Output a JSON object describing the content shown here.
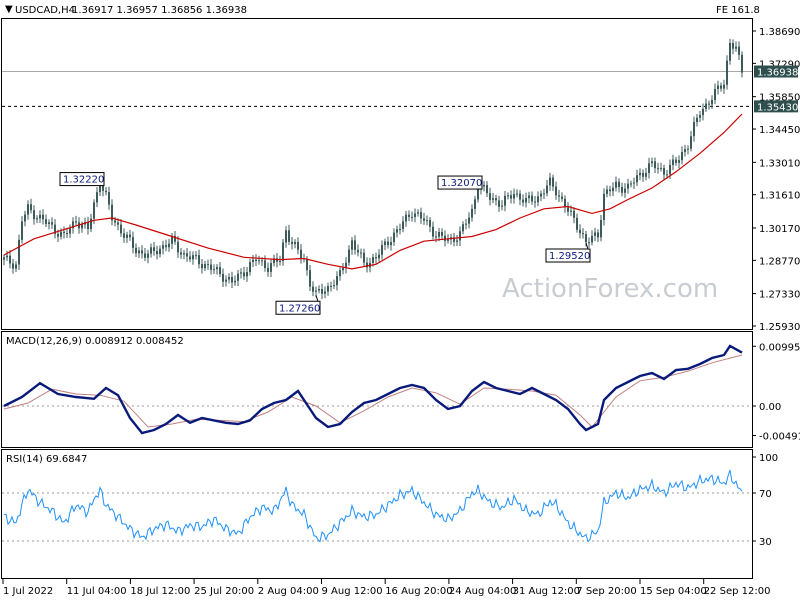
{
  "header": {
    "symbol": "USDCAD,H4",
    "ohlc": "1.36917 1.36957 1.36856 1.36938",
    "fe_label": "FE 161.8"
  },
  "watermark": "ActionForex.com",
  "colors": {
    "candles": "#3c5a5a",
    "ma": "#cc0000",
    "macd": "#0a1a7a",
    "signal": "#c08080",
    "rsi": "#1e90ff",
    "price_tag_bg": "#2f4f4f"
  },
  "chart_data": [
    {
      "type": "candlestick",
      "panel": "price",
      "ylim": [
        1.2593,
        1.3869
      ],
      "yticks": [
        "1.38690",
        "1.37290",
        "1.35850",
        "1.34450",
        "1.33010",
        "1.31610",
        "1.30170",
        "1.28770",
        "1.27330",
        "1.25930"
      ],
      "current_price": "1.36938",
      "level_line": "1.35430",
      "annotations": [
        {
          "label": "1.32220",
          "x": 16,
          "y": 1.3222
        },
        {
          "label": "1.27260",
          "x": 52,
          "y": 1.2726
        },
        {
          "label": "1.32070",
          "x": 79,
          "y": 1.3207
        },
        {
          "label": "1.29520",
          "x": 97,
          "y": 1.2952
        }
      ],
      "close_path": [
        [
          0,
          1.288
        ],
        [
          2,
          1.286
        ],
        [
          3,
          1.305
        ],
        [
          4,
          1.31
        ],
        [
          6,
          1.306
        ],
        [
          8,
          1.302
        ],
        [
          10,
          1.298
        ],
        [
          12,
          1.305
        ],
        [
          14,
          1.301
        ],
        [
          15,
          1.312
        ],
        [
          16,
          1.3222
        ],
        [
          17,
          1.315
        ],
        [
          18,
          1.306
        ],
        [
          20,
          1.299
        ],
        [
          22,
          1.292
        ],
        [
          24,
          1.29
        ],
        [
          26,
          1.293
        ],
        [
          28,
          1.296
        ],
        [
          30,
          1.29
        ],
        [
          32,
          1.288
        ],
        [
          34,
          1.285
        ],
        [
          36,
          1.282
        ],
        [
          38,
          1.278
        ],
        [
          40,
          1.283
        ],
        [
          42,
          1.288
        ],
        [
          44,
          1.285
        ],
        [
          46,
          1.288
        ],
        [
          47,
          1.301
        ],
        [
          48,
          1.295
        ],
        [
          50,
          1.288
        ],
        [
          51,
          1.278
        ],
        [
          52,
          1.2726
        ],
        [
          54,
          1.276
        ],
        [
          56,
          1.281
        ],
        [
          58,
          1.296
        ],
        [
          60,
          1.286
        ],
        [
          62,
          1.289
        ],
        [
          64,
          1.296
        ],
        [
          66,
          1.302
        ],
        [
          68,
          1.309
        ],
        [
          70,
          1.305
        ],
        [
          72,
          1.299
        ],
        [
          74,
          1.296
        ],
        [
          76,
          1.299
        ],
        [
          78,
          1.309
        ],
        [
          79,
          1.3207
        ],
        [
          81,
          1.315
        ],
        [
          83,
          1.312
        ],
        [
          85,
          1.317
        ],
        [
          87,
          1.313
        ],
        [
          89,
          1.315
        ],
        [
          91,
          1.321
        ],
        [
          92,
          1.318
        ],
        [
          94,
          1.309
        ],
        [
          96,
          1.301
        ],
        [
          97,
          1.2952
        ],
        [
          99,
          1.299
        ],
        [
          100,
          1.316
        ],
        [
          102,
          1.32
        ],
        [
          104,
          1.319
        ],
        [
          106,
          1.325
        ],
        [
          108,
          1.329
        ],
        [
          110,
          1.326
        ],
        [
          112,
          1.33
        ],
        [
          114,
          1.338
        ],
        [
          116,
          1.352
        ],
        [
          118,
          1.358
        ],
        [
          120,
          1.365
        ],
        [
          121,
          1.382
        ],
        [
          122,
          1.379
        ],
        [
          123,
          1.3694
        ]
      ],
      "ma_path": [
        [
          0,
          1.29
        ],
        [
          5,
          1.297
        ],
        [
          10,
          1.301
        ],
        [
          15,
          1.305
        ],
        [
          18,
          1.306
        ],
        [
          22,
          1.303
        ],
        [
          28,
          1.298
        ],
        [
          34,
          1.293
        ],
        [
          40,
          1.289
        ],
        [
          46,
          1.288
        ],
        [
          50,
          1.2885
        ],
        [
          54,
          1.286
        ],
        [
          58,
          1.284
        ],
        [
          62,
          1.286
        ],
        [
          66,
          1.292
        ],
        [
          70,
          1.296
        ],
        [
          74,
          1.297
        ],
        [
          78,
          1.298
        ],
        [
          82,
          1.301
        ],
        [
          86,
          1.306
        ],
        [
          90,
          1.31
        ],
        [
          94,
          1.311
        ],
        [
          98,
          1.308
        ],
        [
          101,
          1.31
        ],
        [
          104,
          1.314
        ],
        [
          108,
          1.319
        ],
        [
          112,
          1.326
        ],
        [
          116,
          1.334
        ],
        [
          120,
          1.343
        ],
        [
          123,
          1.351
        ]
      ]
    },
    {
      "type": "line",
      "panel": "macd",
      "title": "MACD(12,26,9) 0.008912 0.008452",
      "ylim": [
        -0.006,
        0.011
      ],
      "yticks": [
        "0.009956",
        "0.00",
        "-0.004912"
      ],
      "series": [
        {
          "values": [
            [
              0,
              0.0
            ],
            [
              3,
              0.0015
            ],
            [
              6,
              0.0038
            ],
            [
              9,
              0.002
            ],
            [
              12,
              0.0015
            ],
            [
              15,
              0.0012
            ],
            [
              17,
              0.003
            ],
            [
              19,
              0.0018
            ],
            [
              21,
              -0.002
            ],
            [
              23,
              -0.0045
            ],
            [
              25,
              -0.004
            ],
            [
              27,
              -0.003
            ],
            [
              29,
              -0.0015
            ],
            [
              31,
              -0.0028
            ],
            [
              33,
              -0.002
            ],
            [
              35,
              -0.0024
            ],
            [
              37,
              -0.0028
            ],
            [
              39,
              -0.003
            ],
            [
              41,
              -0.0024
            ],
            [
              43,
              -0.0005
            ],
            [
              45,
              0.0005
            ],
            [
              47,
              0.001
            ],
            [
              49,
              0.0025
            ],
            [
              51,
              -0.0005
            ],
            [
              52,
              -0.002
            ],
            [
              54,
              -0.0035
            ],
            [
              56,
              -0.003
            ],
            [
              58,
              -0.001
            ],
            [
              60,
              0.0005
            ],
            [
              62,
              0.001
            ],
            [
              64,
              0.002
            ],
            [
              66,
              0.003
            ],
            [
              68,
              0.0035
            ],
            [
              70,
              0.003
            ],
            [
              72,
              0.001
            ],
            [
              74,
              -0.0005
            ],
            [
              76,
              0.0
            ],
            [
              78,
              0.0025
            ],
            [
              80,
              0.004
            ],
            [
              82,
              0.003
            ],
            [
              84,
              0.0025
            ],
            [
              86,
              0.002
            ],
            [
              88,
              0.003
            ],
            [
              90,
              0.002
            ],
            [
              92,
              0.001
            ],
            [
              94,
              -0.0005
            ],
            [
              96,
              -0.003
            ],
            [
              97,
              -0.004
            ],
            [
              99,
              -0.003
            ],
            [
              100,
              0.001
            ],
            [
              102,
              0.003
            ],
            [
              104,
              0.004
            ],
            [
              106,
              0.005
            ],
            [
              108,
              0.0055
            ],
            [
              110,
              0.0045
            ],
            [
              112,
              0.006
            ],
            [
              114,
              0.0062
            ],
            [
              116,
              0.007
            ],
            [
              118,
              0.008
            ],
            [
              120,
              0.0085
            ],
            [
              121,
              0.01
            ],
            [
              123,
              0.0089
            ]
          ]
        },
        {
          "values": [
            [
              0,
              -0.0005
            ],
            [
              4,
              0.0005
            ],
            [
              8,
              0.0028
            ],
            [
              12,
              0.002
            ],
            [
              16,
              0.0018
            ],
            [
              20,
              0.0008
            ],
            [
              24,
              -0.0035
            ],
            [
              28,
              -0.003
            ],
            [
              32,
              -0.0022
            ],
            [
              36,
              -0.0024
            ],
            [
              40,
              -0.0026
            ],
            [
              44,
              -0.001
            ],
            [
              48,
              0.0015
            ],
            [
              52,
              0.0
            ],
            [
              56,
              -0.0028
            ],
            [
              60,
              -0.0008
            ],
            [
              64,
              0.0015
            ],
            [
              68,
              0.003
            ],
            [
              72,
              0.0022
            ],
            [
              76,
              0.0003
            ],
            [
              80,
              0.003
            ],
            [
              84,
              0.0028
            ],
            [
              88,
              0.0025
            ],
            [
              92,
              0.0018
            ],
            [
              96,
              -0.0015
            ],
            [
              98,
              -0.0035
            ],
            [
              102,
              0.0015
            ],
            [
              106,
              0.0042
            ],
            [
              110,
              0.0048
            ],
            [
              114,
              0.0058
            ],
            [
              118,
              0.0072
            ],
            [
              123,
              0.0085
            ]
          ]
        }
      ]
    },
    {
      "type": "line",
      "panel": "rsi",
      "title": "RSI(14) 69.6847",
      "ylim": [
        0,
        100
      ],
      "yticks": [
        "100",
        "70",
        "30"
      ],
      "series": [
        {
          "values": [
            [
              0,
              50
            ],
            [
              2,
              45
            ],
            [
              3,
              60
            ],
            [
              4,
              73
            ],
            [
              6,
              62
            ],
            [
              8,
              55
            ],
            [
              10,
              45
            ],
            [
              12,
              60
            ],
            [
              14,
              54
            ],
            [
              15,
              65
            ],
            [
              16,
              72
            ],
            [
              17,
              60
            ],
            [
              19,
              50
            ],
            [
              21,
              40
            ],
            [
              23,
              33
            ],
            [
              25,
              40
            ],
            [
              27,
              44
            ],
            [
              29,
              38
            ],
            [
              31,
              43
            ],
            [
              33,
              42
            ],
            [
              35,
              48
            ],
            [
              37,
              40
            ],
            [
              39,
              36
            ],
            [
              41,
              50
            ],
            [
              43,
              58
            ],
            [
              45,
              55
            ],
            [
              47,
              72
            ],
            [
              48,
              60
            ],
            [
              50,
              52
            ],
            [
              52,
              32
            ],
            [
              54,
              35
            ],
            [
              56,
              45
            ],
            [
              58,
              55
            ],
            [
              60,
              50
            ],
            [
              62,
              52
            ],
            [
              64,
              60
            ],
            [
              66,
              68
            ],
            [
              68,
              72
            ],
            [
              70,
              62
            ],
            [
              72,
              52
            ],
            [
              74,
              48
            ],
            [
              76,
              55
            ],
            [
              78,
              70
            ],
            [
              79,
              72
            ],
            [
              81,
              62
            ],
            [
              83,
              58
            ],
            [
              85,
              65
            ],
            [
              87,
              55
            ],
            [
              89,
              52
            ],
            [
              91,
              63
            ],
            [
              92,
              60
            ],
            [
              94,
              45
            ],
            [
              96,
              36
            ],
            [
              97,
              32
            ],
            [
              99,
              38
            ],
            [
              100,
              62
            ],
            [
              102,
              70
            ],
            [
              104,
              66
            ],
            [
              106,
              73
            ],
            [
              108,
              76
            ],
            [
              110,
              70
            ],
            [
              112,
              78
            ],
            [
              114,
              74
            ],
            [
              116,
              80
            ],
            [
              118,
              82
            ],
            [
              120,
              78
            ],
            [
              121,
              85
            ],
            [
              123,
              70
            ]
          ]
        }
      ]
    }
  ],
  "xaxis_labels": [
    "1 Jul 2022",
    "11 Jul 04:00",
    "18 Jul 12:00",
    "25 Jul 20:00",
    "2 Aug 04:00",
    "9 Aug 12:00",
    "16 Aug 20:00",
    "24 Aug 04:00",
    "31 Aug 12:00",
    "7 Sep 20:00",
    "15 Sep 04:00",
    "22 Sep 12:00"
  ]
}
